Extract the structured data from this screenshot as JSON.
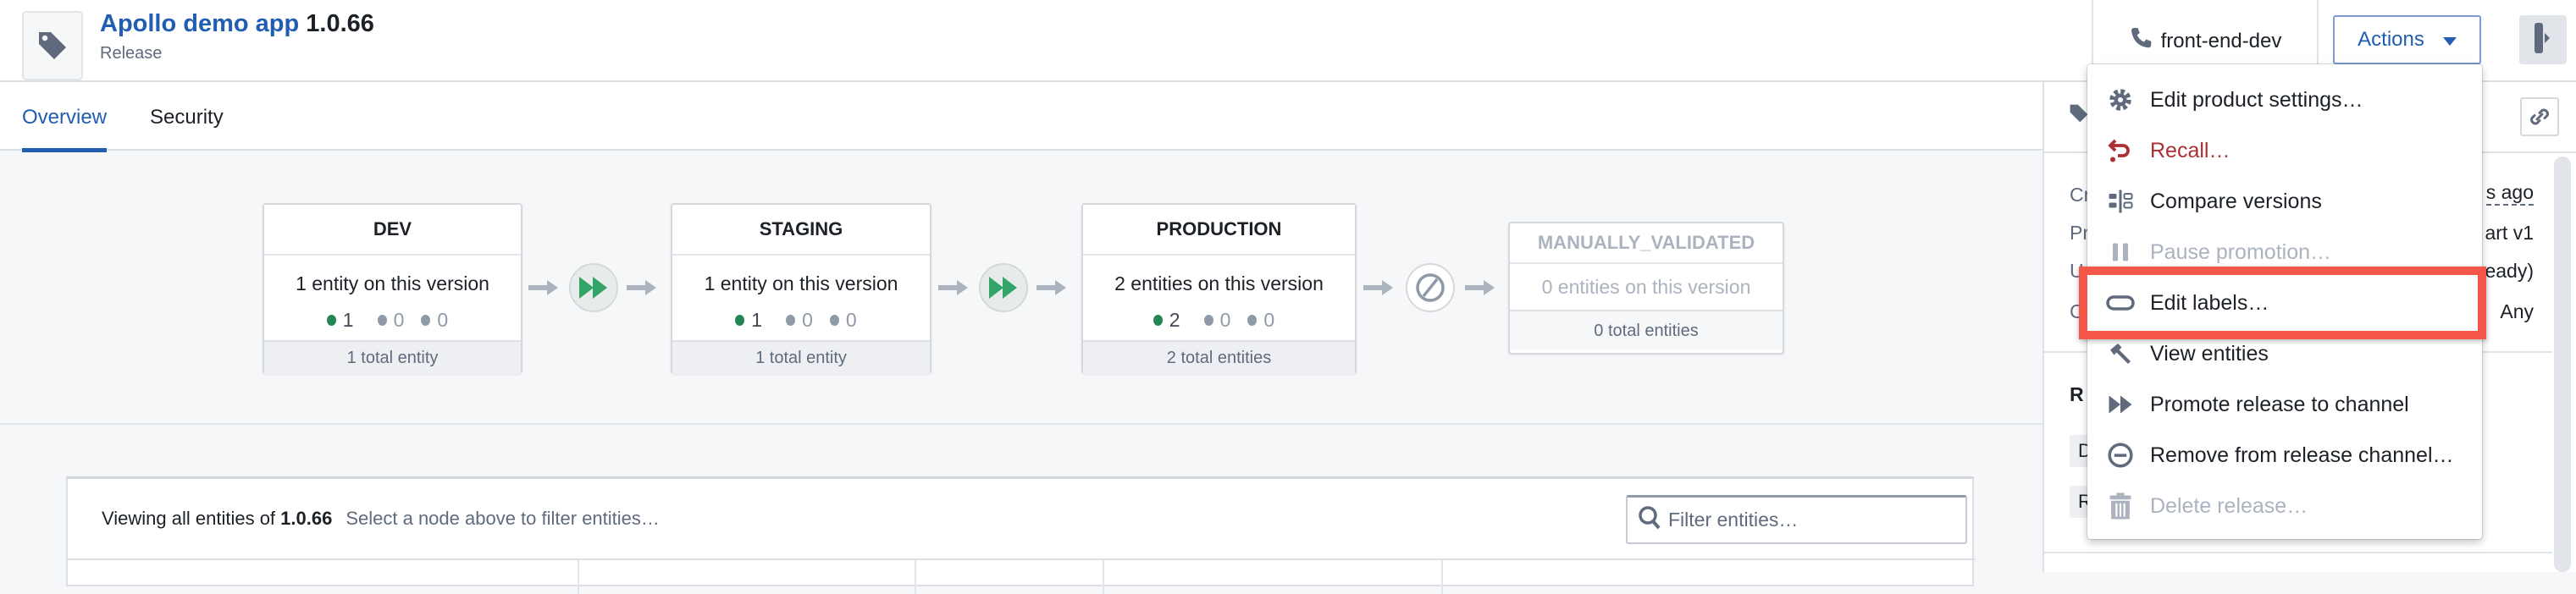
{
  "header": {
    "app_name": "Apollo demo app",
    "version": "1.0.66",
    "subtitle": "Release",
    "owner": "front-end-dev",
    "actions_label": "Actions"
  },
  "tabs": [
    {
      "label": "Overview",
      "active": true
    },
    {
      "label": "Security",
      "active": false
    }
  ],
  "pipeline": [
    {
      "name": "DEV",
      "summary": "1 entity on this version",
      "counts": [
        "1",
        "0",
        "0"
      ],
      "total": "1 total entity",
      "enabled": true
    },
    {
      "name": "STAGING",
      "summary": "1 entity on this version",
      "counts": [
        "1",
        "0",
        "0"
      ],
      "total": "1 total entity",
      "enabled": true
    },
    {
      "name": "PRODUCTION",
      "summary": "2 entities on this version",
      "counts": [
        "2",
        "0",
        "0"
      ],
      "total": "2 total entities",
      "enabled": true
    },
    {
      "name": "MANUALLY_VALIDATED",
      "summary": "0 entities on this version",
      "total": "0 total entities",
      "enabled": false
    }
  ],
  "entities": {
    "viewing_prefix": "Viewing all entities of",
    "version": "1.0.66",
    "hint": "Select a node above to filter entities…",
    "filter_placeholder": "Filter entities…"
  },
  "panel": {
    "rows": [
      {
        "label": "Cr",
        "value": "s ago"
      },
      {
        "label": "Pr",
        "value": "art v1"
      },
      {
        "label": "U",
        "value": "eady)"
      },
      {
        "label": "C",
        "value": "Any"
      }
    ],
    "section": "R",
    "chips": [
      "D",
      "R"
    ]
  },
  "menu": {
    "items": [
      {
        "label": "Edit product settings…",
        "icon": "gear-icon",
        "state": "normal"
      },
      {
        "label": "Recall…",
        "icon": "undo-icon",
        "state": "danger"
      },
      {
        "label": "Compare versions",
        "icon": "compare-icon",
        "state": "normal"
      },
      {
        "label": "Pause promotion…",
        "icon": "pause-icon",
        "state": "disabled"
      },
      {
        "label": "Edit labels…",
        "icon": "label-icon",
        "state": "highlighted"
      },
      {
        "label": "View entities",
        "icon": "hammer-icon",
        "state": "normal"
      },
      {
        "label": "Promote release to channel",
        "icon": "fast-forward-icon",
        "state": "normal"
      },
      {
        "label": "Remove from release channel…",
        "icon": "remove-circle-icon",
        "state": "normal"
      },
      {
        "label": "Delete release…",
        "icon": "trash-icon",
        "state": "disabled"
      }
    ]
  },
  "colors": {
    "accent": "#215db0",
    "success": "#238551",
    "danger": "#ac2f33",
    "highlight": "#f5564a"
  }
}
